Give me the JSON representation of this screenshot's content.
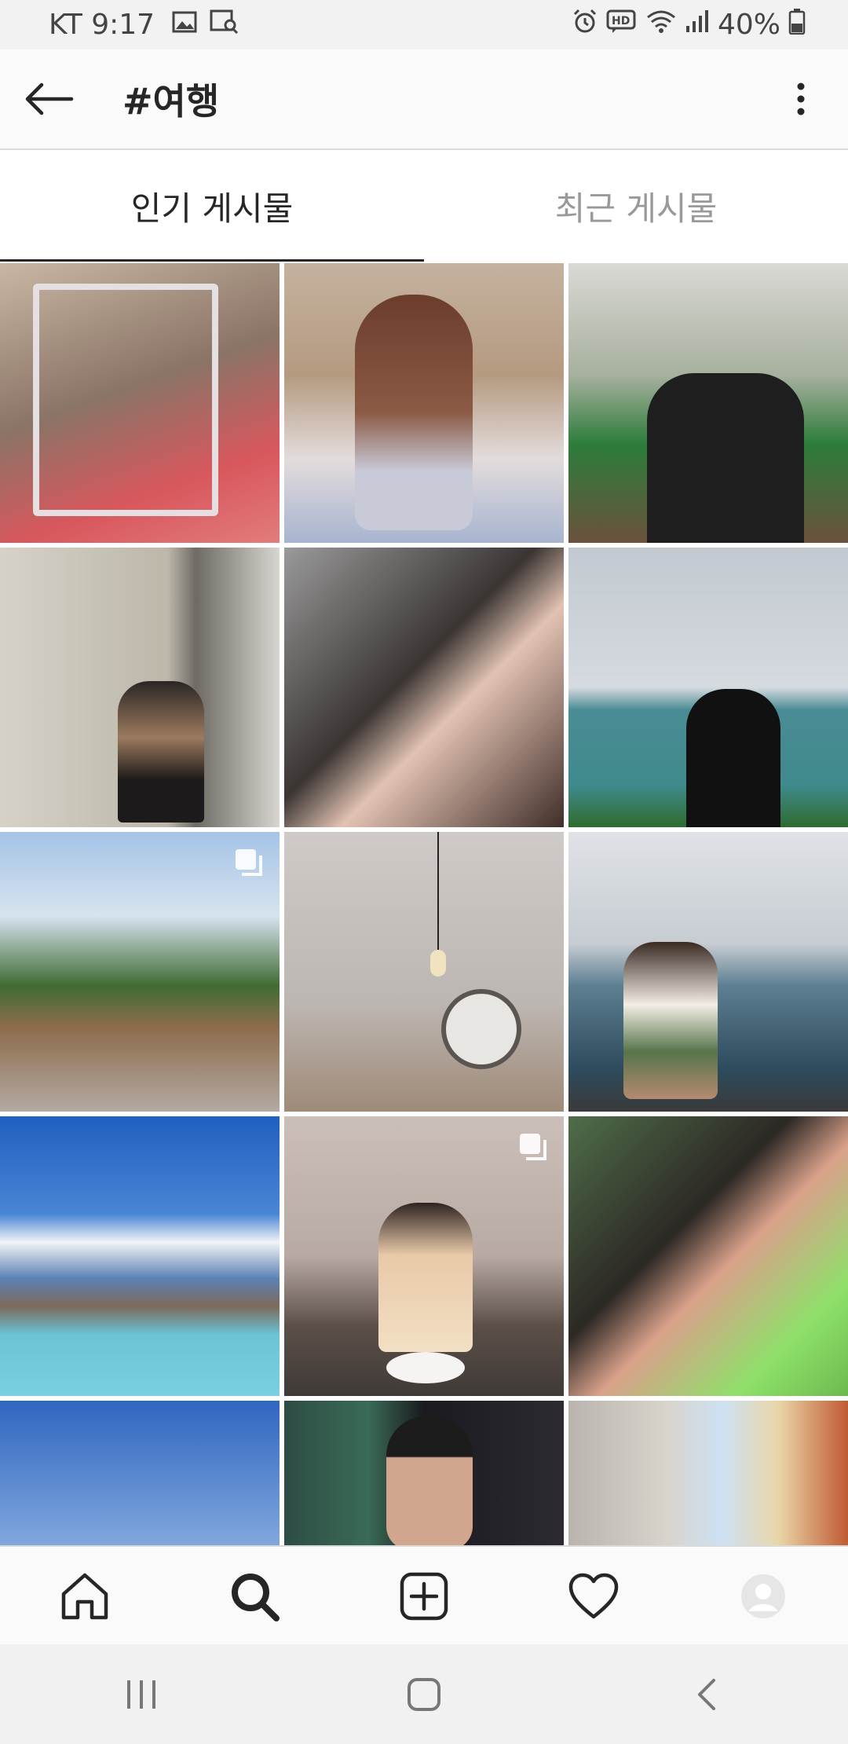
{
  "status_bar": {
    "carrier_time": "KT 9:17",
    "battery": "40%",
    "left_icons": [
      "gallery-icon",
      "image-search-icon"
    ],
    "right_icons": [
      "alarm-icon",
      "hd-voice-icon",
      "wifi-icon",
      "signal-icon",
      "battery-icon"
    ]
  },
  "header": {
    "title": "#여행"
  },
  "tabs": [
    {
      "label": "인기 게시물",
      "active": true
    },
    {
      "label": "최근 게시물",
      "active": false
    }
  ],
  "posts": [
    {
      "multi": false
    },
    {
      "multi": false
    },
    {
      "multi": false
    },
    {
      "multi": false
    },
    {
      "multi": false
    },
    {
      "multi": false
    },
    {
      "multi": true
    },
    {
      "multi": false
    },
    {
      "multi": false
    },
    {
      "multi": false
    },
    {
      "multi": true
    },
    {
      "multi": false
    },
    {
      "multi": false
    },
    {
      "multi": false
    },
    {
      "multi": false
    }
  ],
  "bottom_nav": [
    "home-icon",
    "search-icon",
    "new-post-icon",
    "activity-heart-icon",
    "profile-avatar"
  ],
  "system_nav": [
    "recent-apps-icon",
    "home-button-icon",
    "back-nav-icon"
  ],
  "colors": {
    "header_bg": "#fafafa",
    "text_primary": "#262626",
    "text_inactive": "#999999",
    "divider": "#dbdbdb",
    "system_nav_bg": "#f1f1f1"
  }
}
